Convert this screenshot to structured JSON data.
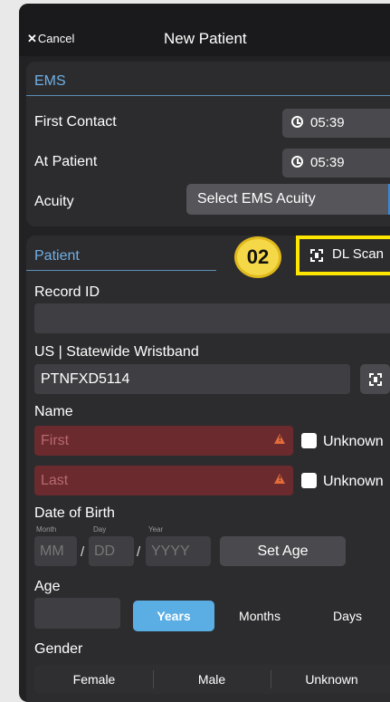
{
  "nav": {
    "cancel_label": "Cancel",
    "title": "New Patient"
  },
  "ems": {
    "heading": "EMS",
    "first_contact_label": "First Contact",
    "first_contact_time": "05:39",
    "at_patient_label": "At Patient",
    "at_patient_time": "05:39",
    "acuity_label": "Acuity",
    "acuity_value": "Select EMS Acuity"
  },
  "patient": {
    "heading": "Patient",
    "step_badge": "02",
    "dl_scan_label": "DL Scan",
    "record_id_label": "Record ID",
    "record_id_value": "",
    "wristband_label": "US | Statewide Wristband",
    "wristband_value": "PTNFXD5114",
    "name_label": "Name",
    "first_placeholder": "First",
    "last_placeholder": "Last",
    "unknown_label": "Unknown",
    "dob_label": "Date of Birth",
    "dob_month_caption": "Month",
    "dob_day_caption": "Day",
    "dob_year_caption": "Year",
    "dob_month_placeholder": "MM",
    "dob_day_placeholder": "DD",
    "dob_year_placeholder": "YYYY",
    "dob_separator": "/",
    "set_age_label": "Set Age",
    "age_label": "Age",
    "age_value": "",
    "age_units": [
      "Years",
      "Months",
      "Days"
    ],
    "age_units_selected": "Years",
    "gender_label": "Gender",
    "gender_options": [
      "Female",
      "Male",
      "Unknown"
    ]
  },
  "colors": {
    "accent_blue": "#5aaee4",
    "heading_blue": "#6fb0e6",
    "highlight_yellow": "#ffe600",
    "error_red": "#6a2a2e"
  }
}
